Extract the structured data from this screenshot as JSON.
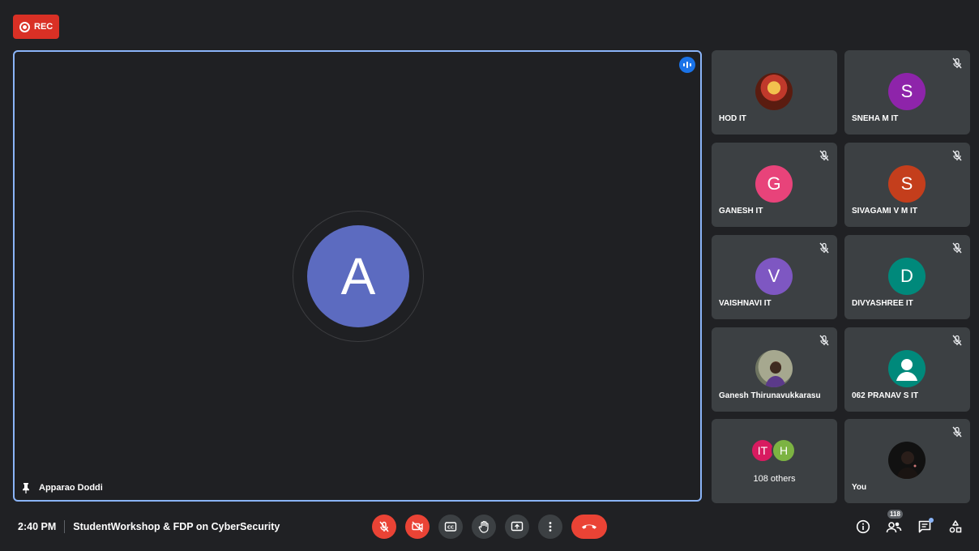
{
  "recording": {
    "label": "REC",
    "color": "#d93025"
  },
  "main_tile": {
    "participant_name": "Apparao Doddi",
    "avatar_letter": "A",
    "avatar_color": "#5c6bc0",
    "highlight_color": "#8ab4f8",
    "icons": [
      "speaking-indicator-icon",
      "pin-icon"
    ]
  },
  "participants": [
    {
      "name": "HOD IT",
      "avatar": "photo",
      "avatar_color": "#6d2a1a",
      "muted": false
    },
    {
      "name": "SNEHA M IT",
      "avatar_letter": "S",
      "avatar_color": "#8e24aa",
      "muted": true
    },
    {
      "name": "GANESH IT",
      "avatar_letter": "G",
      "avatar_color": "#e8437a",
      "muted": true
    },
    {
      "name": "SIVAGAMI V M IT",
      "avatar_letter": "S",
      "avatar_color": "#c43e1c",
      "muted": true
    },
    {
      "name": "VAISHNAVI IT",
      "avatar_letter": "V",
      "avatar_color": "#7e57c2",
      "muted": true
    },
    {
      "name": "DIVYASHREE IT",
      "avatar_letter": "D",
      "avatar_color": "#00897b",
      "muted": true
    },
    {
      "name": "Ganesh Thirunavukkarasu",
      "avatar": "photo",
      "avatar_color": "#8a8f7a",
      "muted": true
    },
    {
      "name": "062 PRANAV S IT",
      "avatar": "default-person",
      "avatar_color": "#00897b",
      "muted": true
    },
    {
      "name": "You",
      "avatar": "photo",
      "avatar_color": "#111111",
      "muted": true
    }
  ],
  "others": {
    "label": "108 others",
    "avatars": [
      {
        "letters": "IT",
        "color": "#d81b60"
      },
      {
        "letters": "H",
        "color": "#7cb342"
      }
    ]
  },
  "bottom_bar": {
    "time": "2:40 PM",
    "meeting_title": "StudentWorkshop & FDP on CyberSecurity",
    "controls": [
      "mic-off-icon",
      "camera-off-icon",
      "captions-icon",
      "raise-hand-icon",
      "present-icon",
      "more-options-icon",
      "hang-up-icon"
    ],
    "people_count": "118",
    "right_icons": [
      "info-icon",
      "people-icon",
      "chat-icon",
      "activities-icon"
    ],
    "danger_color": "#ea4335"
  }
}
